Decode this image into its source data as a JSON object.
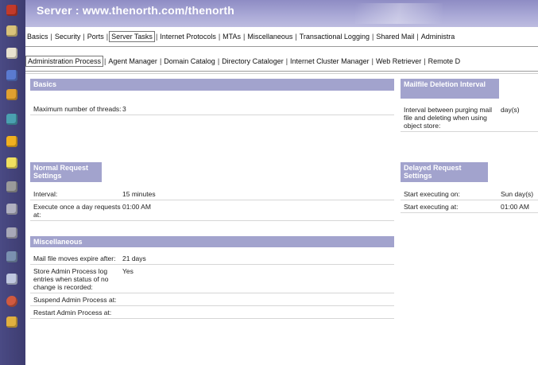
{
  "window": {
    "title": "Server : www.thenorth.com/thenorth"
  },
  "tabs_primary": [
    {
      "label": "Basics",
      "active": false
    },
    {
      "label": "Security",
      "active": false
    },
    {
      "label": "Ports",
      "active": false
    },
    {
      "label": "Server Tasks",
      "active": true
    },
    {
      "label": "Internet Protocols",
      "active": false
    },
    {
      "label": "MTAs",
      "active": false
    },
    {
      "label": "Miscellaneous",
      "active": false
    },
    {
      "label": "Transactional Logging",
      "active": false
    },
    {
      "label": "Shared Mail",
      "active": false
    },
    {
      "label": "Administra",
      "active": false
    }
  ],
  "tabs_secondary": [
    {
      "label": "Administration Process",
      "active": true
    },
    {
      "label": "Agent Manager",
      "active": false
    },
    {
      "label": "Domain Catalog",
      "active": false
    },
    {
      "label": "Directory Cataloger",
      "active": false
    },
    {
      "label": "Internet Cluster Manager",
      "active": false
    },
    {
      "label": "Web Retriever",
      "active": false
    },
    {
      "label": "Remote D",
      "active": false
    }
  ],
  "basics": {
    "header": "Basics",
    "rows": [
      {
        "label": "Maximum number of threads:",
        "value": "3"
      }
    ]
  },
  "normal_request": {
    "header": "Normal Request Settings",
    "rows": [
      {
        "label": "Interval:",
        "value": "15 minutes"
      },
      {
        "label": "Execute once a day requests at:",
        "value": "01:00 AM"
      }
    ]
  },
  "miscellaneous": {
    "header": "Miscellaneous",
    "rows": [
      {
        "label": "Mail file moves expire after:",
        "value": "21 days"
      },
      {
        "label": "Store Admin Process log entries when status of no change is recorded:",
        "value": "Yes"
      },
      {
        "label": "Suspend Admin Process at:",
        "value": ""
      },
      {
        "label": "Restart Admin Process at:",
        "value": ""
      }
    ]
  },
  "mailfile_deletion": {
    "header": "Mailfile Deletion Interval",
    "rows": [
      {
        "label": "Interval between purging mail file and deleting when using object store:",
        "value": "day(s)"
      }
    ]
  },
  "delayed_request": {
    "header": "Delayed Request Settings",
    "rows": [
      {
        "label": "Start executing on:",
        "value": "Sun day(s)"
      },
      {
        "label": "Start executing at:",
        "value": "01:00 AM"
      }
    ]
  },
  "colors": {
    "desktop": "#3b3a6e",
    "titlebar": "#a9a8d6",
    "section_header": "#a2a3cd"
  },
  "sidebar_icons": [
    "database-icon",
    "mail-icon",
    "calendar-icon",
    "globe-icon",
    "server-icon",
    "document-icon",
    "folder-icon",
    "network-icon",
    "chart-icon",
    "disk-icon",
    "print-icon",
    "help-icon"
  ]
}
